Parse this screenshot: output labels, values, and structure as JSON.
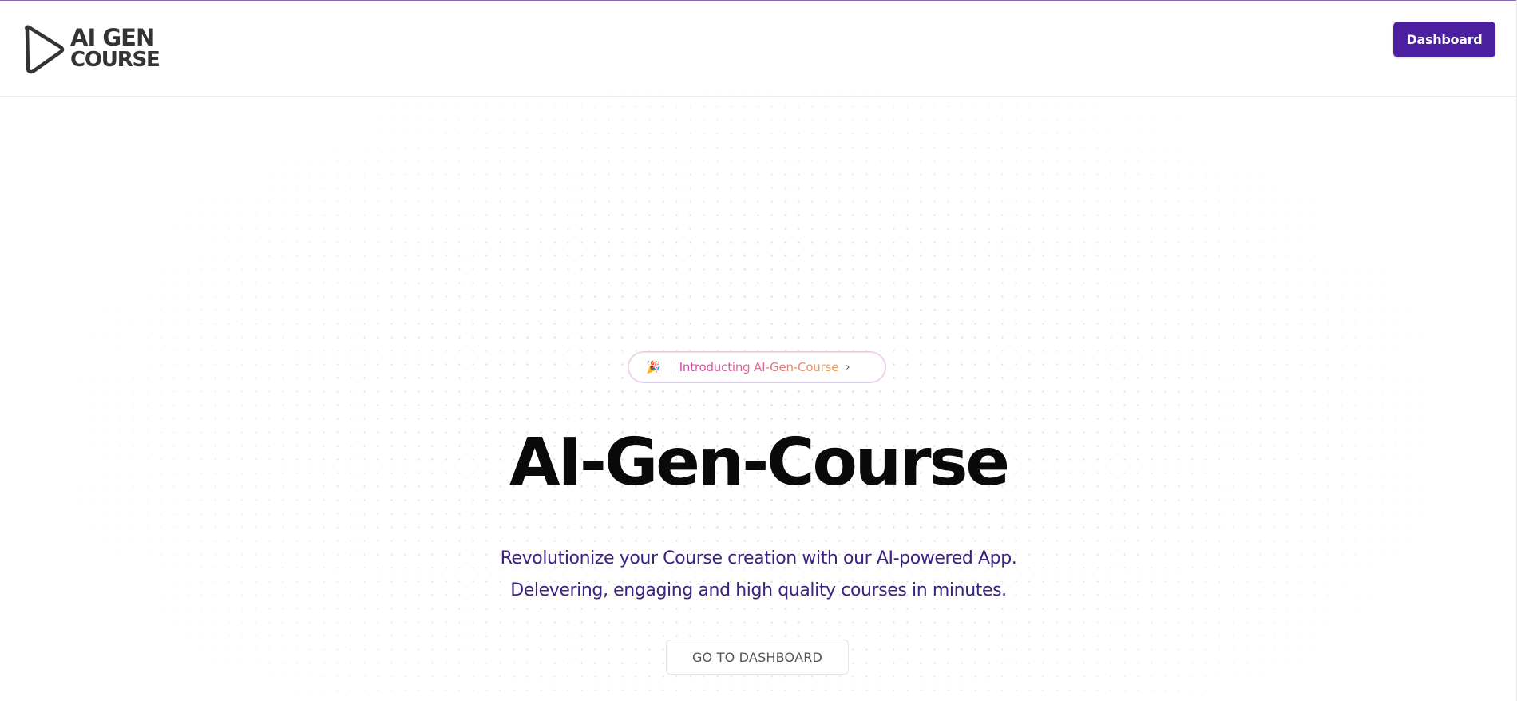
{
  "header": {
    "logo": {
      "line1": "AI GEN",
      "line2": "COURSE"
    },
    "dashboard_button": "Dashboard"
  },
  "hero": {
    "announcement": {
      "icon": "party-popper-icon",
      "glyph": "🎉",
      "text": "Introducting AI-Gen-Course",
      "chevron": "›"
    },
    "title": "AI-Gen-Course",
    "subtitle_line1": "Revolutionize your Course creation with our AI-powered App.",
    "subtitle_line2": "Delevering, engaging and high quality courses in minutes.",
    "cta": "GO TO DASHBOARD"
  },
  "colors": {
    "primary": "#4b1fa0",
    "subtitle": "#3b2280",
    "title": "#0a0a0a",
    "gradient_start": "#c94ab0",
    "gradient_end": "#f0a24a"
  }
}
